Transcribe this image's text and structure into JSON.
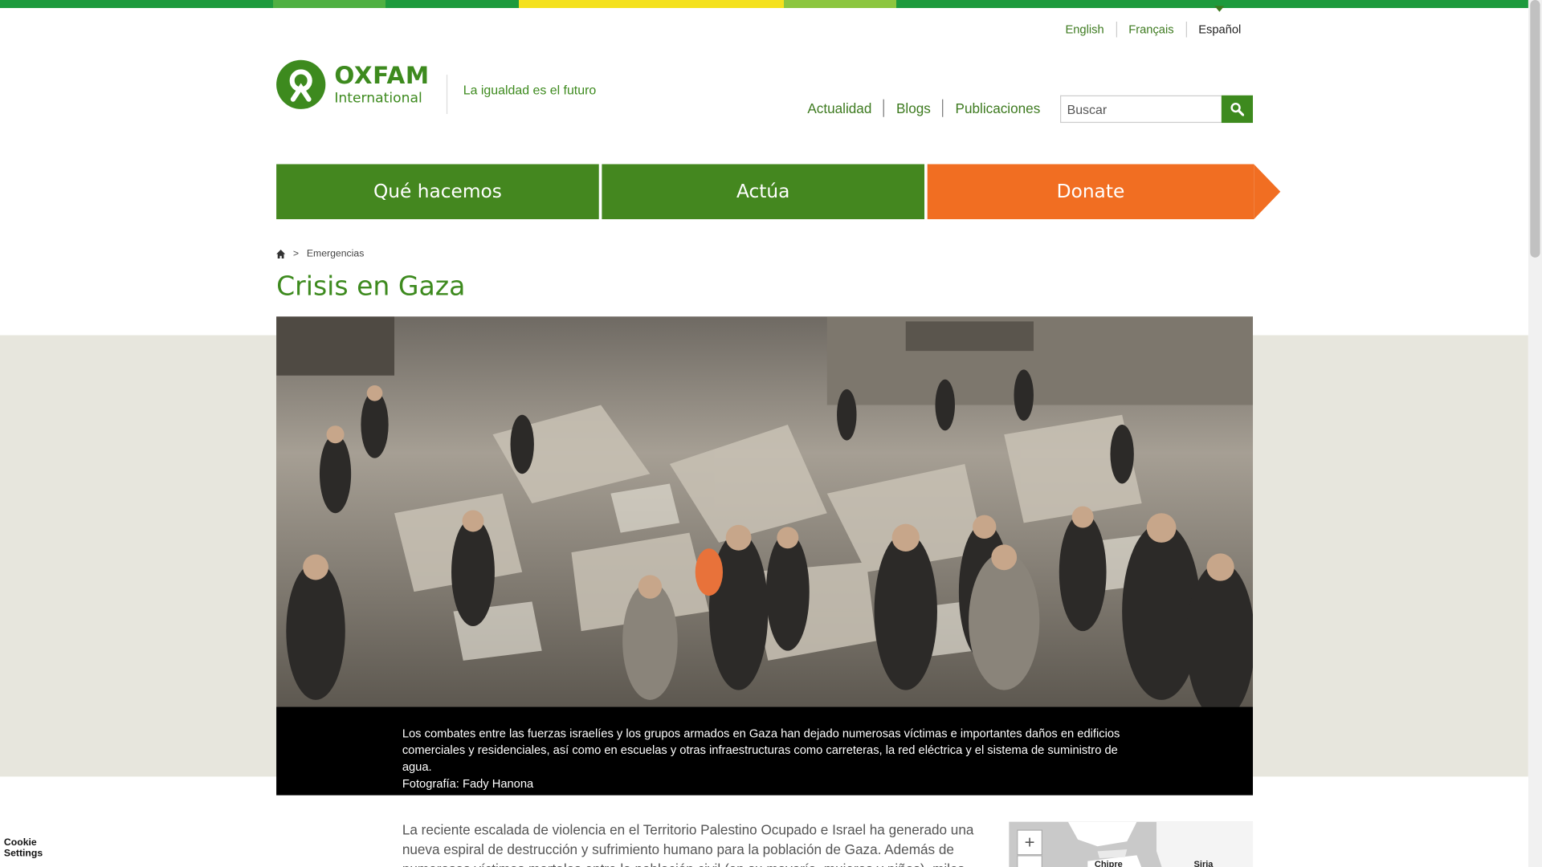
{
  "colors": {
    "brand_green": "#3d8a1e",
    "donate_orange": "#f16e22",
    "stripe": [
      "#1d9a3d",
      "#4fb042",
      "#f4e11d",
      "#8cc63f",
      "#1d9a3d"
    ]
  },
  "languages": [
    {
      "label": "English",
      "active": false
    },
    {
      "label": "Français",
      "active": false
    },
    {
      "label": "Español",
      "active": true
    }
  ],
  "logo": {
    "title": "OXFAM",
    "subtitle": "International",
    "icon": "oxfam-logo-icon"
  },
  "tagline": "La igualdad es el futuro",
  "util_nav": [
    "Actualidad",
    "Blogs",
    "Publicaciones"
  ],
  "search": {
    "placeholder": "Buscar",
    "icon": "search-icon"
  },
  "main_nav": {
    "item1": "Qué hacemos",
    "item2": "Actúa",
    "donate": "Donate"
  },
  "breadcrumb": {
    "home_icon": "home-icon",
    "separator": ">",
    "current": "Emergencias"
  },
  "page_title": "Crisis en Gaza",
  "hero_caption": {
    "text": "Los combates entre las fuerzas israelíes y los grupos armados en Gaza han dejado numerosas víctimas e importantes daños en edificios comerciales y residenciales, así como en escuelas y otras infraestructuras como carreteras, la red eléctrica y el sistema de suministro de agua.",
    "credit": "Fotografía: Fady Hanona"
  },
  "body": {
    "paragraph": "La reciente escalada de violencia en el Territorio Palestino Ocupado e Israel ha generado una nueva espiral de destrucción y sufrimiento humano para la población de Gaza. Además de numerosas víctimas mortales entre la población civil (en su mayoría, mujeres y niños), miles de personas, cuyas"
  },
  "map": {
    "zoom_in": "+",
    "labels": [
      "Chipre",
      "Siria"
    ]
  },
  "cookie": {
    "line1": "Cookie",
    "line2": "Settings"
  }
}
